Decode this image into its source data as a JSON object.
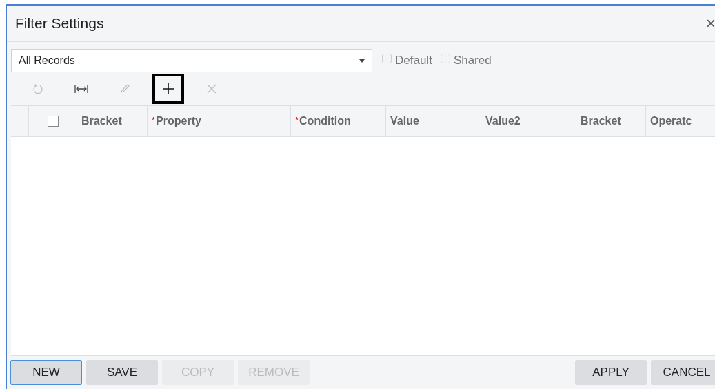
{
  "window": {
    "title": "Filter Settings",
    "close": "×"
  },
  "filter": {
    "value": "All Records",
    "options": [
      {
        "label": "Default",
        "checked": false,
        "disabled": true
      },
      {
        "label": "Shared",
        "checked": false,
        "disabled": true
      }
    ]
  },
  "toolbar": [
    {
      "kind": "refresh",
      "disabled": true,
      "highlighted": false
    },
    {
      "kind": "fit",
      "disabled": false,
      "highlighted": false
    },
    {
      "kind": "edit",
      "disabled": true,
      "highlighted": false
    },
    {
      "kind": "add",
      "disabled": false,
      "highlighted": true
    },
    {
      "kind": "delete",
      "disabled": true,
      "highlighted": false
    }
  ],
  "table": {
    "select_all": {
      "checked": false
    },
    "required_mark": "*",
    "columns": [
      {
        "label": "Bracket",
        "required": false
      },
      {
        "label": "Property",
        "required": true
      },
      {
        "label": "Condition",
        "required": true
      },
      {
        "label": "Value",
        "required": false
      },
      {
        "label": "Value2",
        "required": false
      },
      {
        "label": "Bracket",
        "required": false
      },
      {
        "label": "Operatc",
        "required": false
      }
    ]
  },
  "buttons_left": [
    {
      "label": "NEW",
      "disabled": false,
      "focused": true
    },
    {
      "label": "SAVE",
      "disabled": false,
      "focused": false
    },
    {
      "label": "COPY",
      "disabled": true,
      "focused": false
    },
    {
      "label": "REMOVE",
      "disabled": true,
      "focused": false
    }
  ],
  "buttons_right": [
    {
      "label": "APPLY",
      "disabled": false,
      "focused": false
    },
    {
      "label": "CANCEL",
      "disabled": false,
      "focused": false
    }
  ]
}
